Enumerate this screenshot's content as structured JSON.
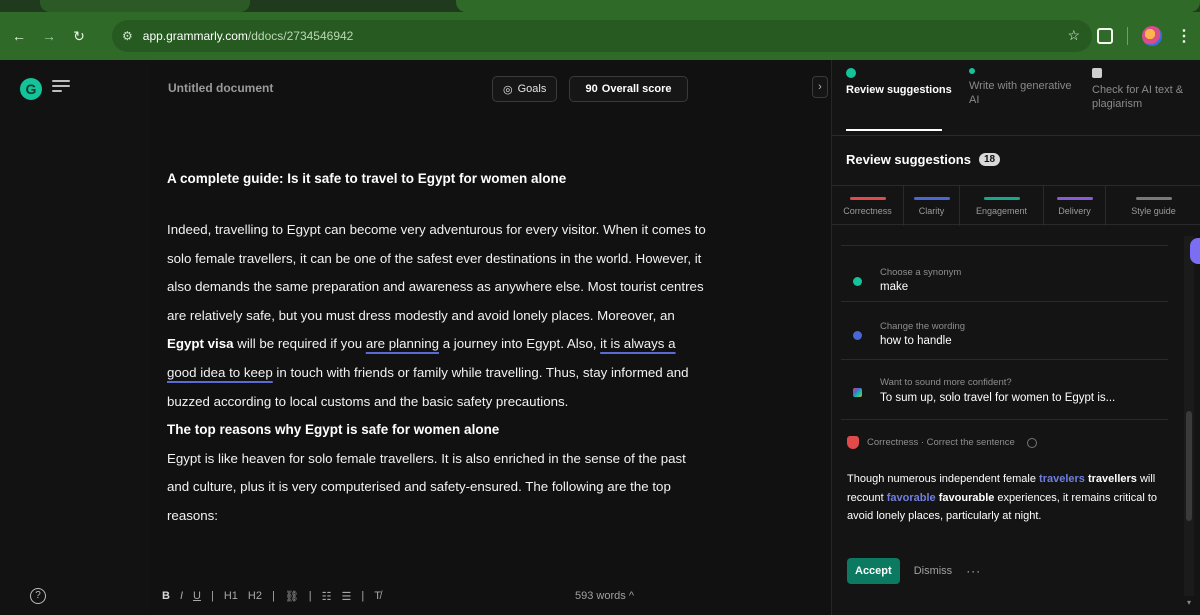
{
  "browser": {
    "url_host": "app.grammarly.com",
    "url_path": "/ddocs/2734546942"
  },
  "doc": {
    "title": "Untitled document",
    "goals_label": "Goals",
    "score_value": "90",
    "score_label": "Overall score",
    "heading": "A complete guide: Is it safe to travel to Egypt for women alone",
    "p1": {
      "a": "Indeed, travelling to Egypt can become very adventurous for every visitor. When it comes to solo female travellers, it can be one of the safest ever destinations in the world. However, it also demands the same preparation and awareness as anywhere else. Most tourist centres are relatively safe, but you must dress modestly and avoid lonely places. Moreover, an ",
      "b": "Egypt visa",
      "c": " will be required if you ",
      "d": "are planning",
      "e": " a journey into Egypt. Also, ",
      "f": "it is always a good idea to keep",
      "g": " in touch with friends or family while travelling. Thus, stay informed and buzzed according to local customs and the basic safety precautions."
    },
    "heading2": "The top reasons why Egypt is safe for women alone",
    "p2": "Egypt is like heaven for solo female travellers. It is also enriched in the sense of the past and culture, plus it is very computerised and safety-ensured. The following are the top reasons:",
    "word_count": "593 words"
  },
  "toolbar": {
    "bold": "B",
    "italic": "I",
    "underline": "U",
    "h1": "H1",
    "h2": "H2",
    "link": "⛓",
    "ol": "☷",
    "ul": "☰",
    "clear": "T̸"
  },
  "panel": {
    "tabs": [
      {
        "label": "Review suggestions",
        "color": "#15c39a"
      },
      {
        "label": "Write with generative AI",
        "color": "#15c39a"
      },
      {
        "label": "Check for AI text & plagiarism",
        "color": "#cfcfcf"
      }
    ],
    "review_title": "Review suggestions",
    "review_count": "18",
    "categories": [
      {
        "label": "Correctness",
        "color": "#e04a4a"
      },
      {
        "label": "Clarity",
        "color": "#4a67d6"
      },
      {
        "label": "Engagement",
        "color": "#15a88a"
      },
      {
        "label": "Delivery",
        "color": "#8a5bd6"
      },
      {
        "label": "Style guide",
        "color": "#7a7a7a"
      }
    ],
    "suggestions": [
      {
        "label": "Choose a synonym",
        "value": "make",
        "color": "#15c39a"
      },
      {
        "label": "Change the wording",
        "value": "how to handle",
        "color": "#4a67d6"
      },
      {
        "label": "Want to sound more confident?",
        "value": "To sum up, solo travel for women to Egypt is...",
        "color": "#e8a23a"
      }
    ],
    "card": {
      "category": "Correctness · Correct the sentence",
      "t1": "Though numerous independent female ",
      "t2": "travelers",
      "t3": " ",
      "t4": "travellers",
      "t5": " will recount ",
      "t6": "favorable",
      "t7": " ",
      "t8": "favourable",
      "t9": " experiences, it remains critical to avoid lonely places, particularly at night.",
      "accept": "Accept",
      "dismiss": "Dismiss",
      "more": "···"
    }
  }
}
